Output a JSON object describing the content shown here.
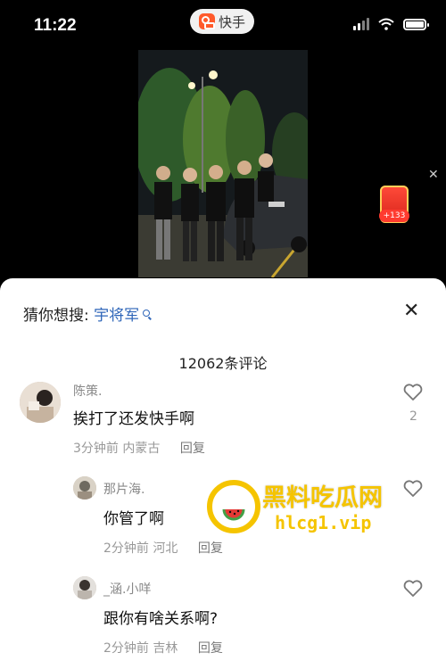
{
  "status_bar": {
    "time": "11:22",
    "app_name": "快手"
  },
  "red_packet": {
    "badge": "+133"
  },
  "sheet": {
    "guess_label": "猜你想搜:",
    "guess_keyword": "宇将军",
    "comment_count": "12062条评论"
  },
  "comments": [
    {
      "author": "陈策.",
      "text": "挨打了还发快手啊",
      "time": "3分钟前",
      "location": "内蒙古",
      "reply": "回复",
      "likes": "2"
    },
    {
      "author": "那片海.",
      "text": "你管了啊",
      "time": "2分钟前",
      "location": "河北",
      "reply": "回复"
    },
    {
      "author": "_涵.小咩",
      "text": "跟你有啥关系啊?",
      "time": "2分钟前",
      "location": "吉林",
      "reply": "回复"
    }
  ],
  "watermark": {
    "title": "黑料吃瓜网",
    "url": "hlcg1.vip"
  },
  "colors": {
    "accent_blue": "#2f66b9",
    "brand_orange": "#ff5a2b",
    "watermark_gold": "#f5c400"
  }
}
